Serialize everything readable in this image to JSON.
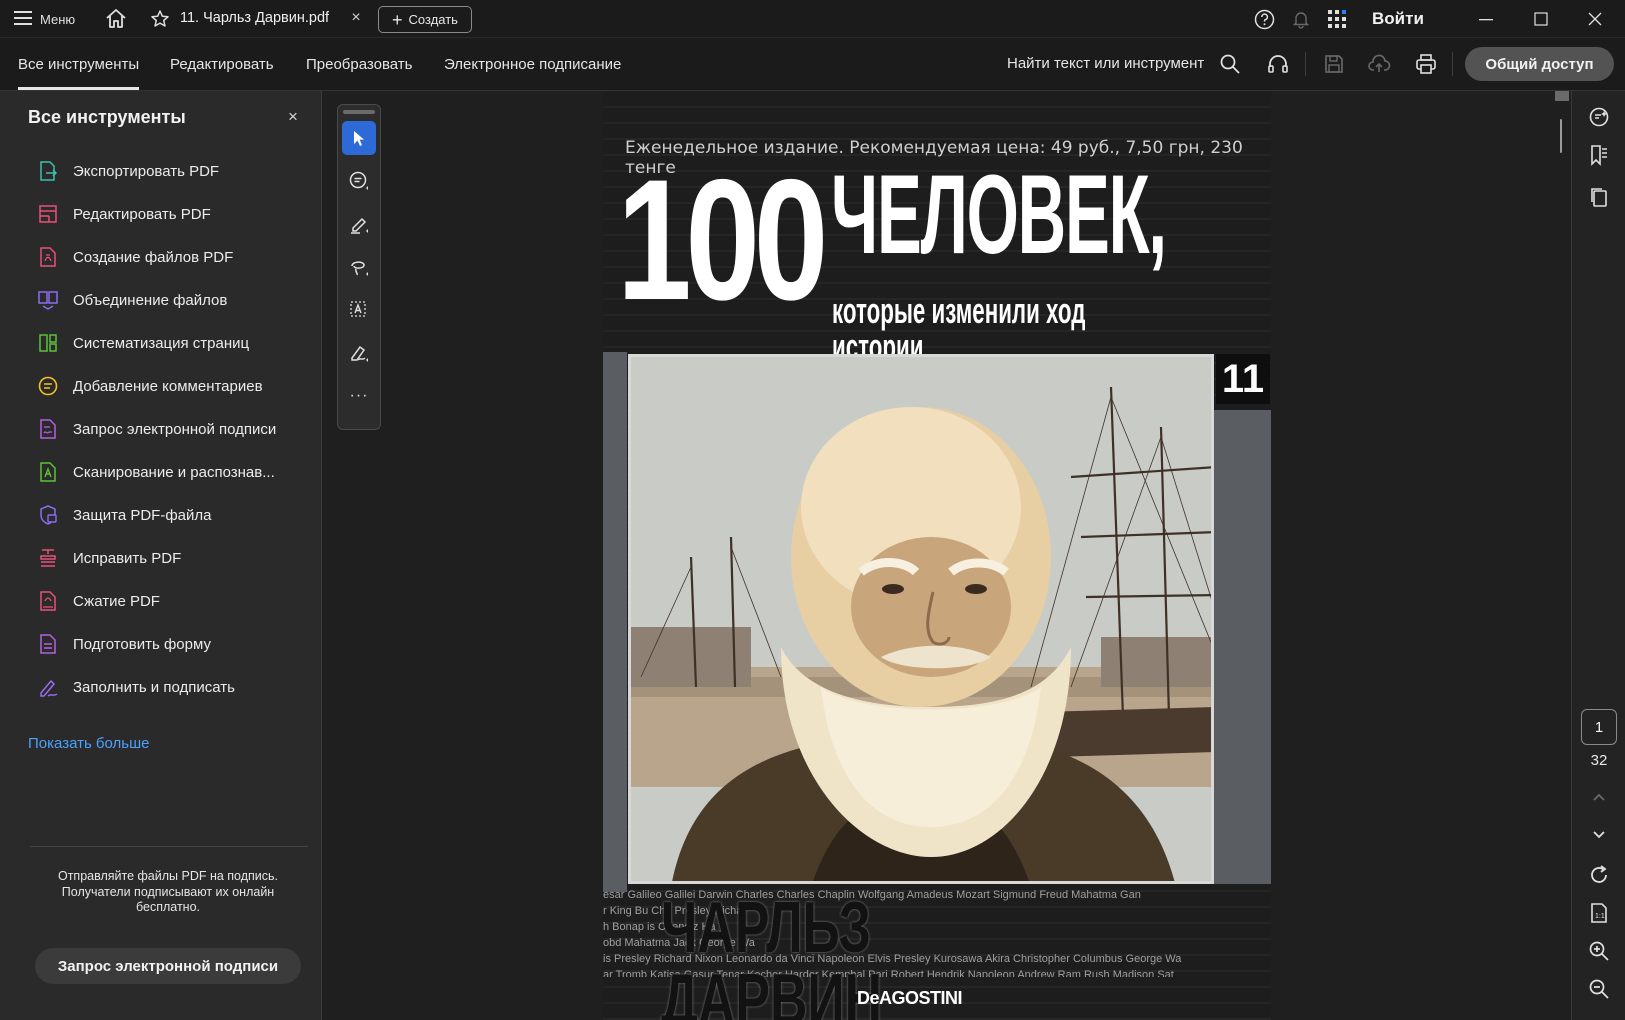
{
  "titlebar": {
    "menu_label": "Меню",
    "tab_title": "11. Чарльз Дарвин.pdf",
    "tab_close": "×",
    "create_label": "Создать",
    "create_plus": "+",
    "signin_label": "Войти"
  },
  "toolbar": {
    "tabs": [
      {
        "label": "Все инструменты",
        "active": true
      },
      {
        "label": "Редактировать",
        "active": false
      },
      {
        "label": "Преобразовать",
        "active": false
      },
      {
        "label": "Электронное подписание",
        "active": false
      }
    ],
    "find_label": "Найти текст или инструмент",
    "share_label": "Общий доступ"
  },
  "left_panel": {
    "title": "Все инструменты",
    "close": "×",
    "items": [
      {
        "label": "Экспортировать PDF",
        "icon": "export-pdf-icon",
        "color": "#3fbfa8"
      },
      {
        "label": "Редактировать PDF",
        "icon": "edit-pdf-icon",
        "color": "#e8507a"
      },
      {
        "label": "Создание файлов PDF",
        "icon": "create-pdf-icon",
        "color": "#e8507a"
      },
      {
        "label": "Объединение файлов",
        "icon": "combine-files-icon",
        "color": "#8a6cf0"
      },
      {
        "label": "Систематизация страниц",
        "icon": "organize-pages-icon",
        "color": "#5bc236"
      },
      {
        "label": "Добавление комментариев",
        "icon": "comment-icon",
        "color": "#f4c025"
      },
      {
        "label": "Запрос электронной подписи",
        "icon": "request-esign-icon",
        "color": "#b45fe0"
      },
      {
        "label": "Сканирование и распознав...",
        "icon": "scan-ocr-icon",
        "color": "#5bc236"
      },
      {
        "label": "Защита PDF-файла",
        "icon": "protect-pdf-icon",
        "color": "#8a6cf0"
      },
      {
        "label": "Исправить PDF",
        "icon": "redact-pdf-icon",
        "color": "#e8507a"
      },
      {
        "label": "Сжатие PDF",
        "icon": "compress-pdf-icon",
        "color": "#e8507a"
      },
      {
        "label": "Подготовить форму",
        "icon": "prepare-form-icon",
        "color": "#b45fe0"
      },
      {
        "label": "Заполнить и подписать",
        "icon": "fill-sign-icon",
        "color": "#9a6cf0"
      }
    ],
    "show_more": "Показать больше",
    "promo_text": "Отправляйте файлы PDF на подпись. Получатели подписывают их онлайн бесплатно.",
    "promo_button": "Запрос электронной подписи"
  },
  "quick_tools": {
    "more": "···"
  },
  "document": {
    "tagline": "Еженедельное издание. Рекомендуемая цена: 49 руб., 7,50 грн, 230 тенге",
    "title_number": "100",
    "title_word": "ЧЕЛОВЕК,",
    "subtitle": "которые изменили ход истории",
    "issue_number": "11",
    "names_strip_1": "esar Galileo Galilei Darwin Charles Charles Chaplin Wolfgang Amadeus Mozart Sigmund Freud Mahatma Gan",
    "names_strip_2": "r King Bu                    Che                              Presley Richa",
    "names_strip_3": "h Bonap                                                        is Chengiz Ha",
    "names_strip_4": "obd Mahatma                                                   Jack George Wa",
    "names_strip_5": "is Presley Richard Nixon Leonardo da Vinci Napoleon Elvis Presley Kurosawa Akira Christopher Columbus George Wa",
    "names_strip_6": "ar Tromb Katisa Gasur Tenar Kecher Harder Kempbal Pari Robert Hendrik Napoleon Andrew Ram Rush Madison Sat",
    "person_name": "ЧАРЛЬЗ ДАРВИН",
    "publisher": "DeAGOSTINI"
  },
  "right_rail": {
    "current_page": "1",
    "total_pages": "32"
  }
}
